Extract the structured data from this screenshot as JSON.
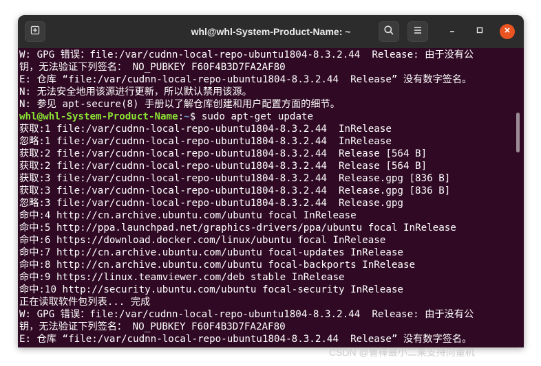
{
  "window": {
    "title": "whl@whl-System-Product-Name: ~"
  },
  "icons": {
    "new_tab": "new-tab-icon",
    "search": "search-icon",
    "menu": "hamburger-menu-icon",
    "minimize": "minimize-icon",
    "maximize": "maximize-icon",
    "close": "close-icon"
  },
  "colors": {
    "terminal_bg": "#300a24",
    "titlebar_bg": "#2c2c2c",
    "prompt_user": "#8ae234",
    "prompt_path": "#729fcf",
    "close_button": "#e95420"
  },
  "terminal": {
    "prompt": {
      "user": "whl@whl-System-Product-Name",
      "sep": ":",
      "path": "~",
      "cmd": "$ sudo apt-get update"
    },
    "lines_before": [
      "W: GPG 错误：file:/var/cudnn-local-repo-ubuntu1804-8.3.2.44  Release: 由于没有公",
      "钥，无法验证下列签名： NO_PUBKEY F60F4B3D7FA2AF80",
      "E: 仓库 “file:/var/cudnn-local-repo-ubuntu1804-8.3.2.44  Release” 没有数字签名。",
      "N: 无法安全地用该源进行更新，所以默认禁用该源。",
      "N: 参见 apt-secure(8) 手册以了解仓库创建和用户配置方面的细节。"
    ],
    "lines_after": [
      "获取:1 file:/var/cudnn-local-repo-ubuntu1804-8.3.2.44  InRelease",
      "忽略:1 file:/var/cudnn-local-repo-ubuntu1804-8.3.2.44  InRelease",
      "获取:2 file:/var/cudnn-local-repo-ubuntu1804-8.3.2.44  Release [564 B]",
      "获取:2 file:/var/cudnn-local-repo-ubuntu1804-8.3.2.44  Release [564 B]",
      "获取:3 file:/var/cudnn-local-repo-ubuntu1804-8.3.2.44  Release.gpg [836 B]",
      "获取:3 file:/var/cudnn-local-repo-ubuntu1804-8.3.2.44  Release.gpg [836 B]",
      "忽略:3 file:/var/cudnn-local-repo-ubuntu1804-8.3.2.44  Release.gpg",
      "命中:4 http://cn.archive.ubuntu.com/ubuntu focal InRelease",
      "命中:5 http://ppa.launchpad.net/graphics-drivers/ppa/ubuntu focal InRelease",
      "命中:6 https://download.docker.com/linux/ubuntu focal InRelease",
      "命中:7 http://cn.archive.ubuntu.com/ubuntu focal-updates InRelease",
      "命中:8 http://cn.archive.ubuntu.com/ubuntu focal-backports InRelease",
      "命中:9 https://linux.teamviewer.com/deb stable InRelease",
      "命中:10 http://security.ubuntu.com/ubuntu focal-security InRelease",
      "正在读取软件包列表... 完成",
      "W: GPG 错误：file:/var/cudnn-local-repo-ubuntu1804-8.3.2.44  Release: 由于没有公",
      "钥，无法验证下列签名： NO_PUBKEY F60F4B3D7FA2AF80",
      "E: 仓库 “file:/var/cudnn-local-repo-ubuntu1804-8.3.2.44  Release” 没有数字签名。"
    ]
  },
  "watermark": "CSDN @鲁棒最小二乘支持向量机"
}
